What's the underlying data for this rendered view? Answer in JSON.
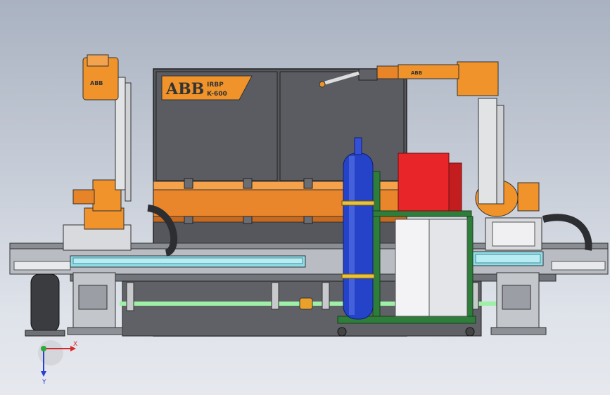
{
  "nameplate": {
    "brand": "ABB",
    "line1": "IRBP",
    "line2": "K-600"
  },
  "robot_left_badge": "ABB",
  "robot_right_badge": "ABB",
  "axes": {
    "x_label": "X",
    "y_label": "Y"
  },
  "colors": {
    "robot_orange": "#f0932b",
    "frame_dark": "#525358",
    "rail_cyan": "#8fdde9",
    "cylinder_blue": "#2443c8",
    "cart_green": "#2f7d3a",
    "controller_red": "#e8262a",
    "shaft_green": "#9ef0a7"
  }
}
